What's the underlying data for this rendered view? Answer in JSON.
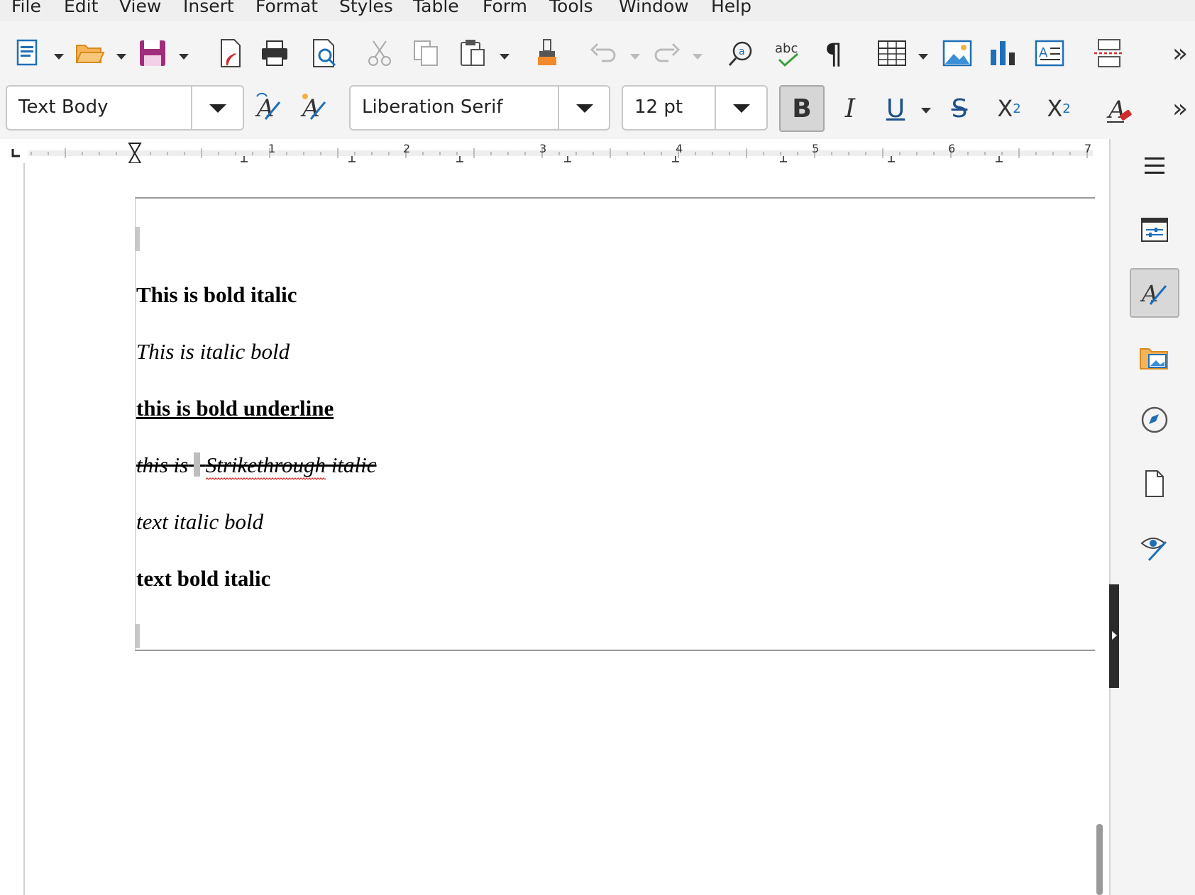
{
  "menu": [
    "File",
    "Edit",
    "View",
    "Insert",
    "Format",
    "Styles",
    "Table",
    "Form",
    "Tools",
    "Window",
    "Help"
  ],
  "toolbar": {
    "paragraph_style": "Text Body",
    "font_name": "Liberation Serif",
    "font_size": "12 pt",
    "bold_label": "B",
    "italic_label": "I",
    "underline_label": "U",
    "strike_label": "S",
    "superscript_label": "X",
    "superscript_exp": "2",
    "subscript_label": "X",
    "subscript_exp": "2",
    "more_label": "»"
  },
  "ruler": {
    "numbers": [
      "1",
      "2",
      "3",
      "4",
      "5",
      "6",
      "7"
    ]
  },
  "document": {
    "lines": [
      "This is bold italic",
      "This is italic bold",
      "this is bold underline",
      "this is",
      "Strikethrough",
      "italic",
      "text italic bold",
      "text bold italic"
    ]
  },
  "colors": {
    "toolbar_bg": "#f4f4f4",
    "menu_bg": "#efefef",
    "spell_error": "#e02020",
    "accent_blue": "#1e6fb8"
  }
}
